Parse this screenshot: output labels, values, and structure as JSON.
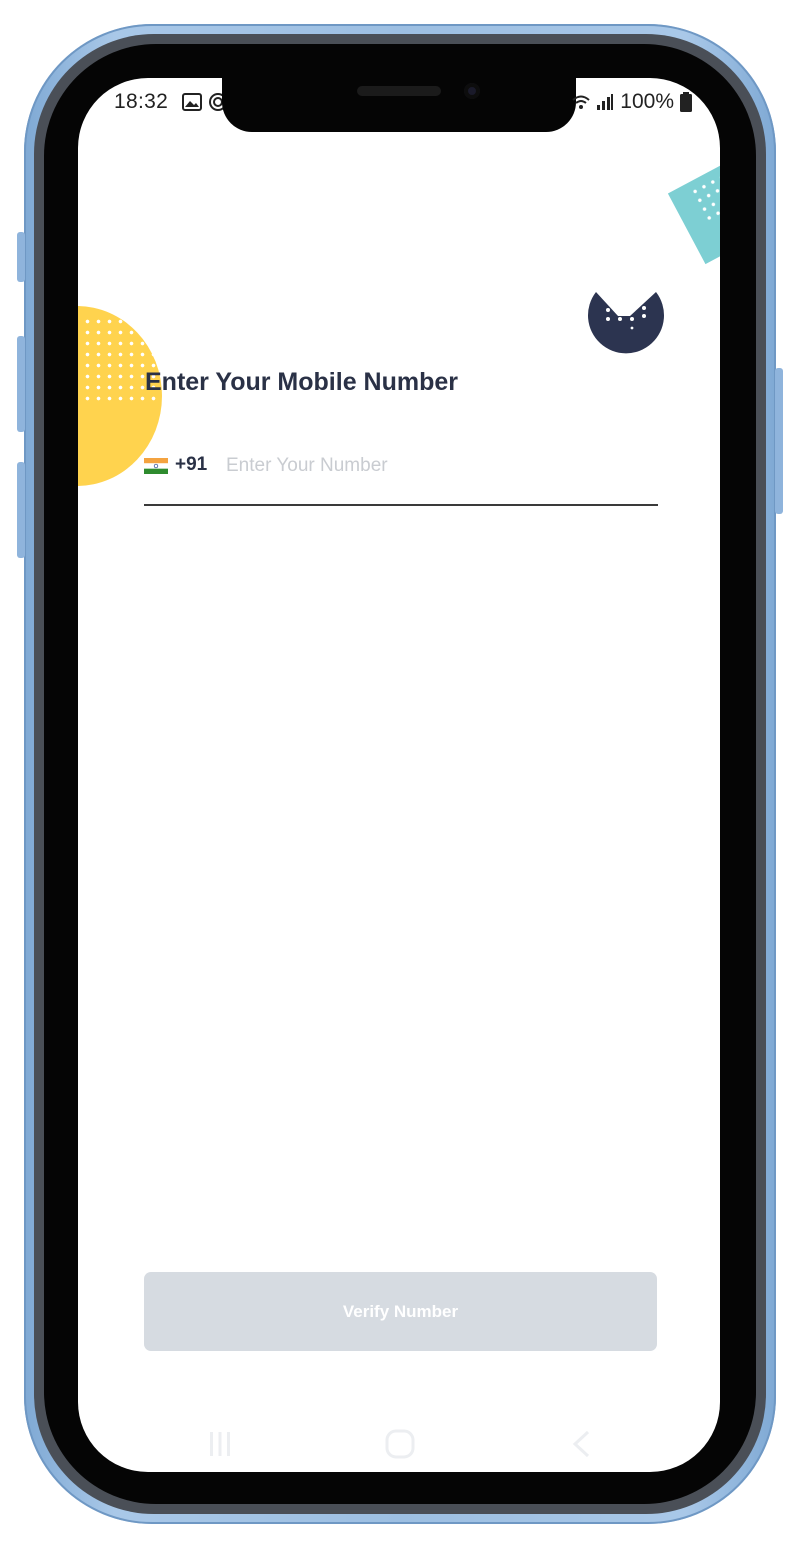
{
  "status_bar": {
    "time": "18:32",
    "battery": "100%",
    "left_icons": [
      "image-icon",
      "sync-icon"
    ],
    "right_icons": [
      "wifi-icon",
      "signal-icon",
      "battery-icon"
    ]
  },
  "colors": {
    "frame": "#9dbfe2",
    "title": "#2a3146",
    "deco_yellow": "#ffd34e",
    "deco_teal": "#7dcfd3",
    "deco_navy": "#2c3450",
    "button_disabled": "#d6dbe1"
  },
  "screen": {
    "title": "Enter Your Mobile Number",
    "country": {
      "flag_icon": "india-flag-icon",
      "code": "+91"
    },
    "phone_input": {
      "value": "",
      "placeholder": "Enter Your Number"
    },
    "verify_button": {
      "label": "Verify Number",
      "enabled": false
    }
  },
  "navigation_bar": {
    "buttons": [
      "recent-apps-icon",
      "home-icon",
      "back-icon"
    ]
  }
}
